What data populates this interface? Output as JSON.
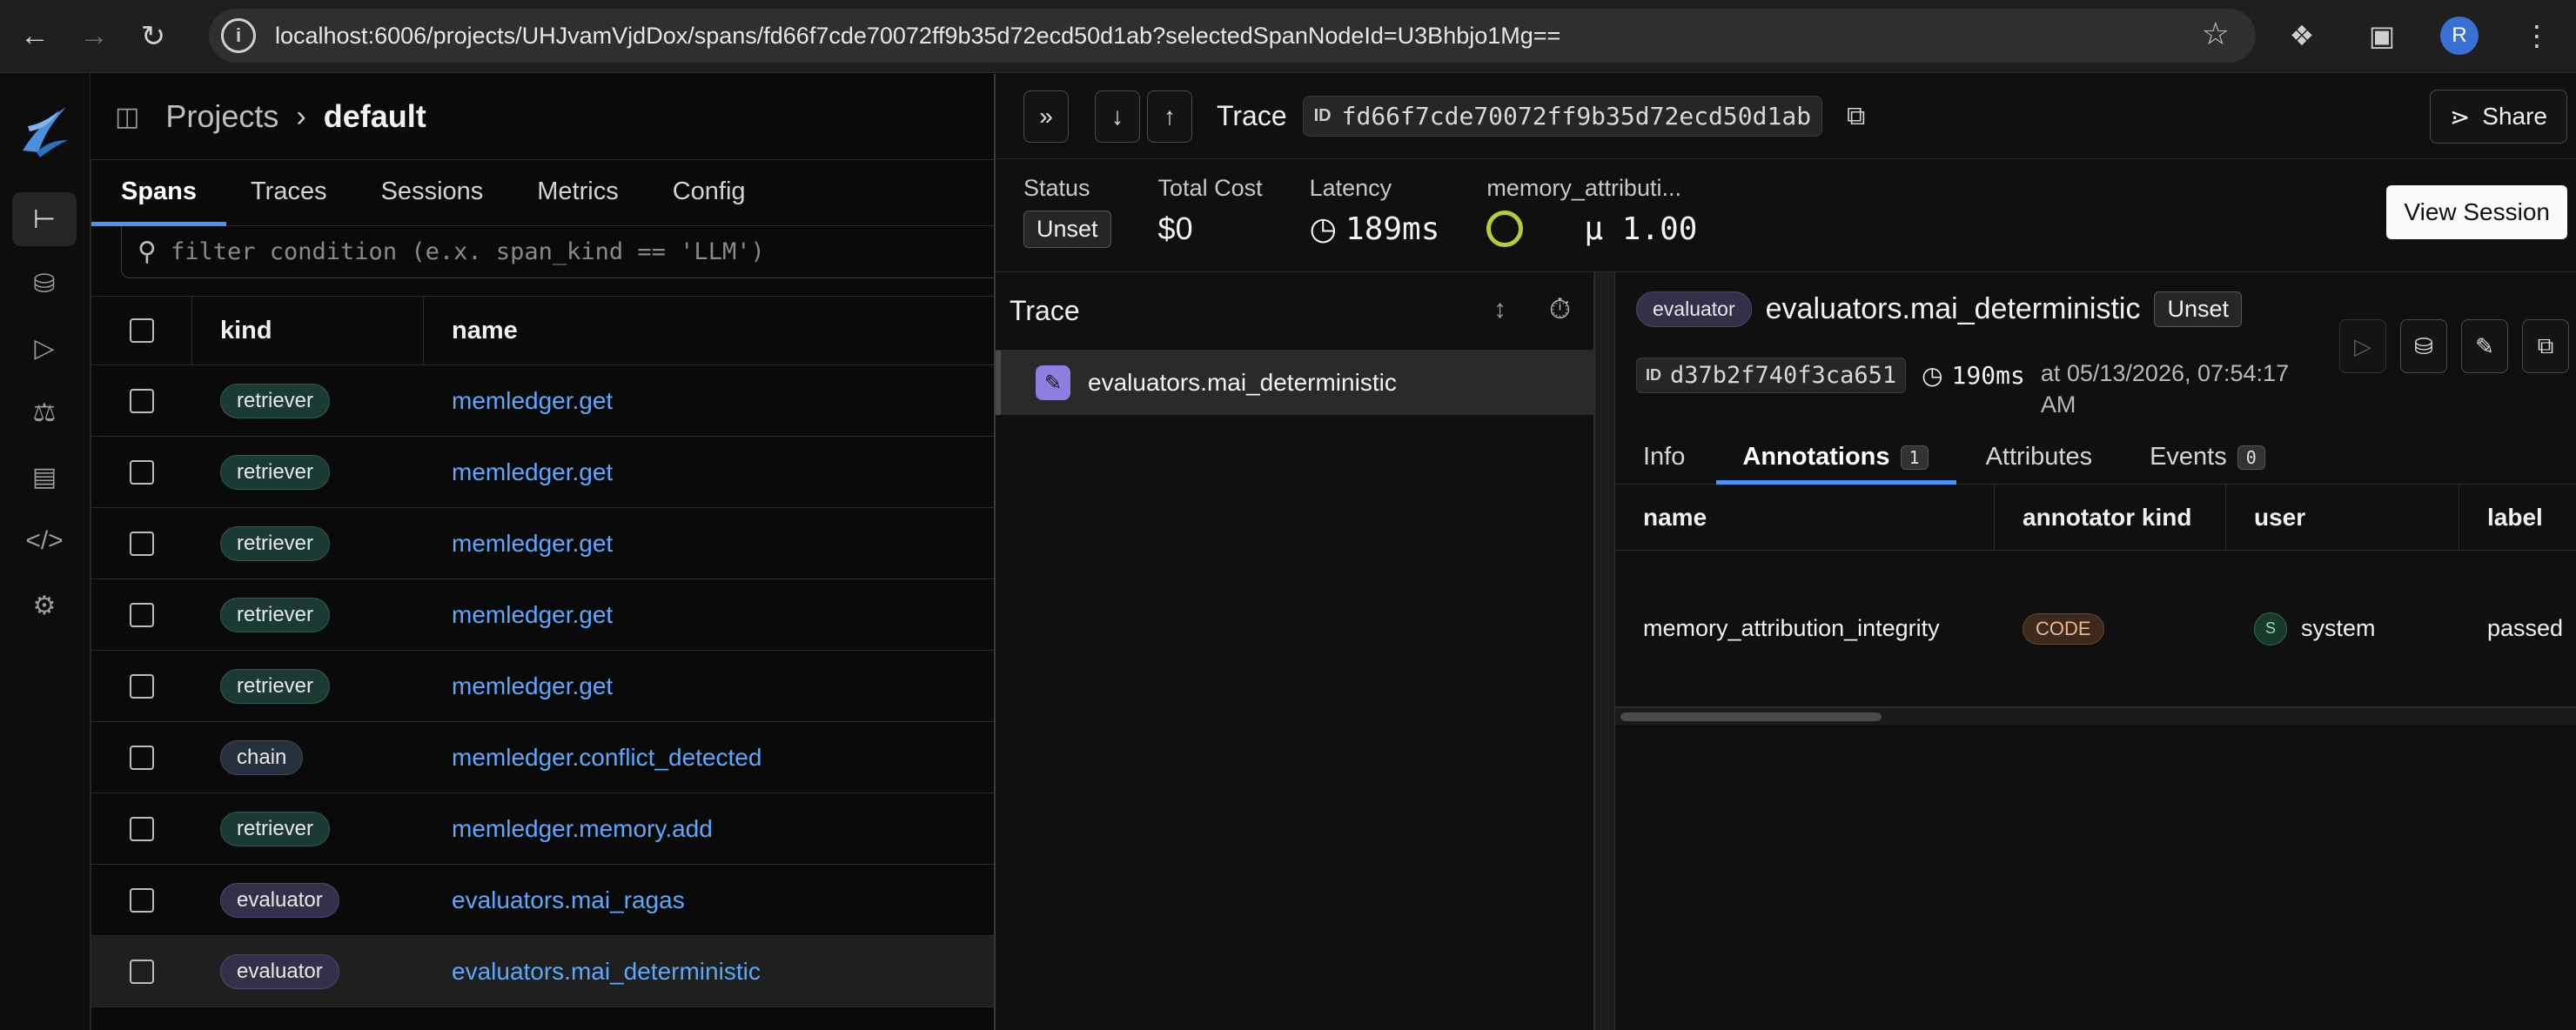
{
  "browser": {
    "url": "localhost:6006/projects/UHJvamVjdDox/spans/fd66f7cde70072ff9b35d72ecd50d1ab?selectedSpanNodeId=U3Bhbjo1Mg==",
    "profile_initial": "R"
  },
  "breadcrumb": {
    "projects": "Projects",
    "project": "default"
  },
  "tabs": [
    "Spans",
    "Traces",
    "Sessions",
    "Metrics",
    "Config"
  ],
  "filter": {
    "placeholder": "filter condition (e.x. span_kind == 'LLM')"
  },
  "spans_table": {
    "columns": [
      "kind",
      "name"
    ],
    "rows": [
      {
        "kind": "retriever",
        "name": "memledger.get"
      },
      {
        "kind": "retriever",
        "name": "memledger.get"
      },
      {
        "kind": "retriever",
        "name": "memledger.get"
      },
      {
        "kind": "retriever",
        "name": "memledger.get"
      },
      {
        "kind": "retriever",
        "name": "memledger.get"
      },
      {
        "kind": "chain",
        "name": "memledger.conflict_detected"
      },
      {
        "kind": "retriever",
        "name": "memledger.memory.add"
      },
      {
        "kind": "evaluator",
        "name": "evaluators.mai_ragas"
      },
      {
        "kind": "evaluator",
        "name": "evaluators.mai_deterministic"
      }
    ]
  },
  "trace": {
    "title": "Trace",
    "id_label": "ID",
    "id": "fd66f7cde70072ff9b35d72ecd50d1ab",
    "share_label": "Share",
    "view_session_label": "View Session",
    "stats": {
      "status_label": "Status",
      "status_value": "Unset",
      "cost_label": "Total Cost",
      "cost_value": "$0",
      "latency_label": "Latency",
      "latency_value": "189ms",
      "metric_label": "memory_attributi...",
      "metric_value": "μ 1.00"
    },
    "tree_title": "Trace",
    "tree_node": "evaluators.mai_deterministic"
  },
  "span_detail": {
    "kind": "evaluator",
    "name": "evaluators.mai_deterministic",
    "status": "Unset",
    "id_label": "ID",
    "id": "d37b2f740f3ca651",
    "duration": "190ms",
    "timestamp": "at 05/13/2026, 07:54:17 AM",
    "tabs": [
      {
        "label": "Info",
        "count": ""
      },
      {
        "label": "Annotations",
        "count": "1"
      },
      {
        "label": "Attributes",
        "count": ""
      },
      {
        "label": "Events",
        "count": "0"
      }
    ],
    "annotations": {
      "columns": [
        "name",
        "annotator kind",
        "user",
        "label"
      ],
      "rows": [
        {
          "name": "memory_attribution_integrity",
          "annotator_kind": "CODE",
          "user_initial": "S",
          "user": "system",
          "label": "passed"
        }
      ]
    }
  },
  "colors": {
    "accent": "#4a90ff",
    "link": "#5ba8ff",
    "metric_ring": "#b8cc3a"
  }
}
